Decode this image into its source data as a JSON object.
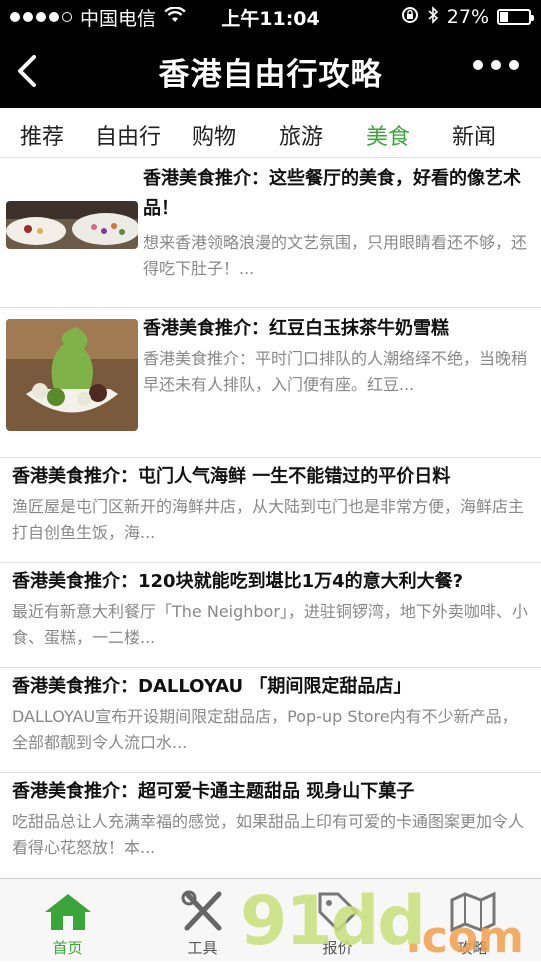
{
  "status_bar": {
    "carrier": "中国电信",
    "time": "上午11:04",
    "battery": "27%",
    "battery_level": 0.27
  },
  "nav": {
    "title": "香港自由行攻略"
  },
  "tabs": [
    {
      "label": "推荐"
    },
    {
      "label": "自由行"
    },
    {
      "label": "购物"
    },
    {
      "label": "旅游"
    },
    {
      "label": "美食"
    },
    {
      "label": "新闻"
    }
  ],
  "active_tab": "美食",
  "articles": [
    {
      "title": "香港美食推介：这些餐厅的美食，好看的像艺术品！",
      "desc": "想来香港领略浪漫的文艺氛围，只用眼睛看还不够，还得吃下肚子！..."
    },
    {
      "title": "香港美食推介：红豆白玉抹茶牛奶雪糕",
      "desc": "香港美食推介：平时门口排队的人潮络绎不绝，当晚稍早还未有人排队，入门便有座。红豆..."
    },
    {
      "title": "香港美食推介：屯门人气海鲜 一生不能错过的平价日料",
      "desc": "渔匠屋是屯门区新开的海鲜井店，从大陆到屯门也是非常方便，海鲜店主打自创鱼生饭，海..."
    },
    {
      "title": "香港美食推介：120块就能吃到堪比1万4的意大利大餐?",
      "desc": "最近有新意大利餐厅「The Neighbor」，进驻铜锣湾，地下外卖咖啡、小食、蛋糕，一二楼..."
    },
    {
      "title": "香港美食推介：DALLOYAU 「期间限定甜品店」",
      "desc": "DALLOYAU宣布开设期间限定甜品店，Pop-up Store内有不少新产品，全部都靓到令人流口水..."
    },
    {
      "title": "香港美食推介：超可爱卡通主题甜品 现身山下菓子",
      "desc": "吃甜品总让人充满幸福的感觉，如果甜品上印有可爱的卡通图案更加令人看得心花怒放！本..."
    }
  ],
  "tabbar": [
    {
      "label": "首页",
      "icon": "home-icon"
    },
    {
      "label": "工具",
      "icon": "tools-icon"
    },
    {
      "label": "报价",
      "icon": "price-tag-icon"
    },
    {
      "label": "攻略",
      "icon": "map-icon"
    }
  ],
  "watermark": {
    "main": "91dd",
    "suffix": ".com"
  },
  "colors": {
    "accent": "#3aa63a",
    "bar": "#000000"
  }
}
